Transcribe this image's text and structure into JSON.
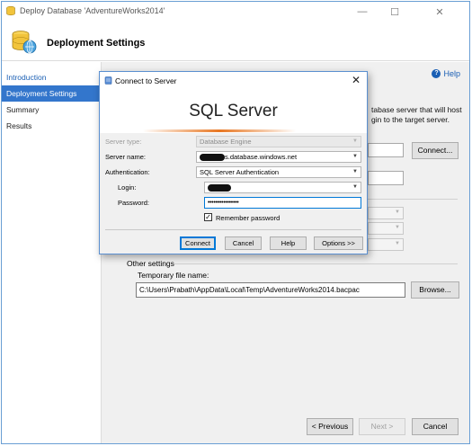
{
  "window": {
    "title": "Deploy Database 'AdventureWorks2014'",
    "controls": {
      "minimize": "—",
      "maximize": "☐",
      "close": "✕"
    }
  },
  "header": {
    "title": "Deployment Settings"
  },
  "nav": {
    "items": [
      {
        "label": "Introduction",
        "state": "link"
      },
      {
        "label": "Deployment Settings",
        "state": "active"
      },
      {
        "label": "Summary",
        "state": "normal"
      },
      {
        "label": "Results",
        "state": "normal"
      }
    ]
  },
  "content": {
    "help_label": "Help",
    "description_line1": "tabase server that will host",
    "description_line2": "gin to the target server.",
    "connect_button": "Connect...",
    "other_settings_label": "Other settings",
    "temp_file_label": "Temporary file name:",
    "temp_file_value": "C:\\Users\\Prabath\\AppData\\Local\\Temp\\AdventureWorks2014.bacpac",
    "browse_button": "Browse...",
    "previous_button": "< Previous",
    "next_button": "Next >",
    "cancel_button": "Cancel"
  },
  "dialog": {
    "title": "Connect to Server",
    "close_glyph": "✕",
    "banner_title": "SQL Server",
    "server_type_label": "Server type:",
    "server_type_value": "Database Engine",
    "server_name_label": "Server name:",
    "server_name_value": "s.database.windows.net",
    "authentication_label": "Authentication:",
    "authentication_value": "SQL Server Authentication",
    "login_label": "Login:",
    "password_label": "Password:",
    "password_value": "••••••••••••••••",
    "remember_password_label": "Remember password",
    "remember_password_checked": true,
    "buttons": {
      "connect": "Connect",
      "cancel": "Cancel",
      "help": "Help",
      "options": "Options >>"
    }
  },
  "colors": {
    "accent_blue": "#3376cc",
    "link_blue": "#1a5fb4",
    "focus_blue": "#0078d7",
    "banner_accent": "#e87722"
  }
}
